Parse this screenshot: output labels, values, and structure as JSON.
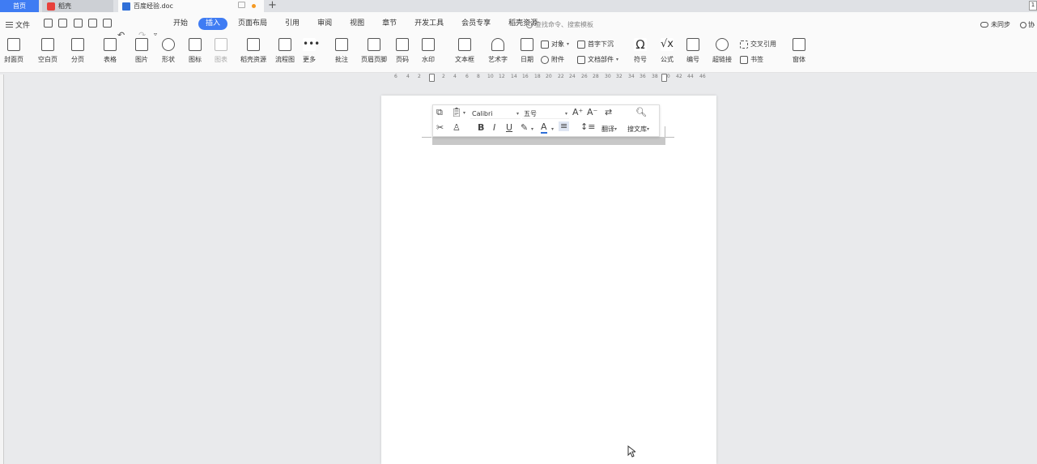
{
  "tabs": {
    "home": "首页",
    "docer": "稻壳",
    "document": "百度经验.doc",
    "new_tab": "+"
  },
  "window_badge": "1",
  "menu": {
    "file": "文件",
    "tabs": [
      "开始",
      "插入",
      "页面布局",
      "引用",
      "审阅",
      "视图",
      "章节",
      "开发工具",
      "会员专享",
      "稻壳资源"
    ],
    "active_tab": "插入",
    "search_placeholder": "查找命令、搜索模板",
    "sync": "未同步",
    "collab": "协"
  },
  "ribbon": {
    "cover": "封面页",
    "blank": "空白页",
    "pagebreak": "分页",
    "table": "表格",
    "picture": "图片",
    "shape": "形状",
    "icon": "图标",
    "chart": "图表",
    "docer_res": "稻壳资源",
    "flowchart": "流程图",
    "more": "更多",
    "comment": "批注",
    "header_footer": "页眉页脚",
    "page_num": "页码",
    "watermark": "水印",
    "textbox": "文本框",
    "wordart": "艺术字",
    "date": "日期",
    "object": "对象",
    "attachment": "附件",
    "dropcap": "首字下沉",
    "doc_parts": "文档部件",
    "symbol": "符号",
    "formula": "公式",
    "numbering": "编号",
    "hyperlink": "超链接",
    "cross_ref": "交叉引用",
    "bookmark": "书签",
    "form": "窗体"
  },
  "ruler": [
    "6",
    "4",
    "2",
    "2",
    "4",
    "6",
    "8",
    "10",
    "12",
    "14",
    "16",
    "18",
    "20",
    "22",
    "24",
    "26",
    "28",
    "30",
    "32",
    "34",
    "36",
    "38",
    "40",
    "42",
    "44",
    "46"
  ],
  "floatbar": {
    "font": "Calibri",
    "size": "五号",
    "translate": "翻译",
    "search_lib": "搜文库"
  },
  "colors": {
    "accent": "#3f7cf3",
    "font_color_bar": "#2f6fd8"
  }
}
